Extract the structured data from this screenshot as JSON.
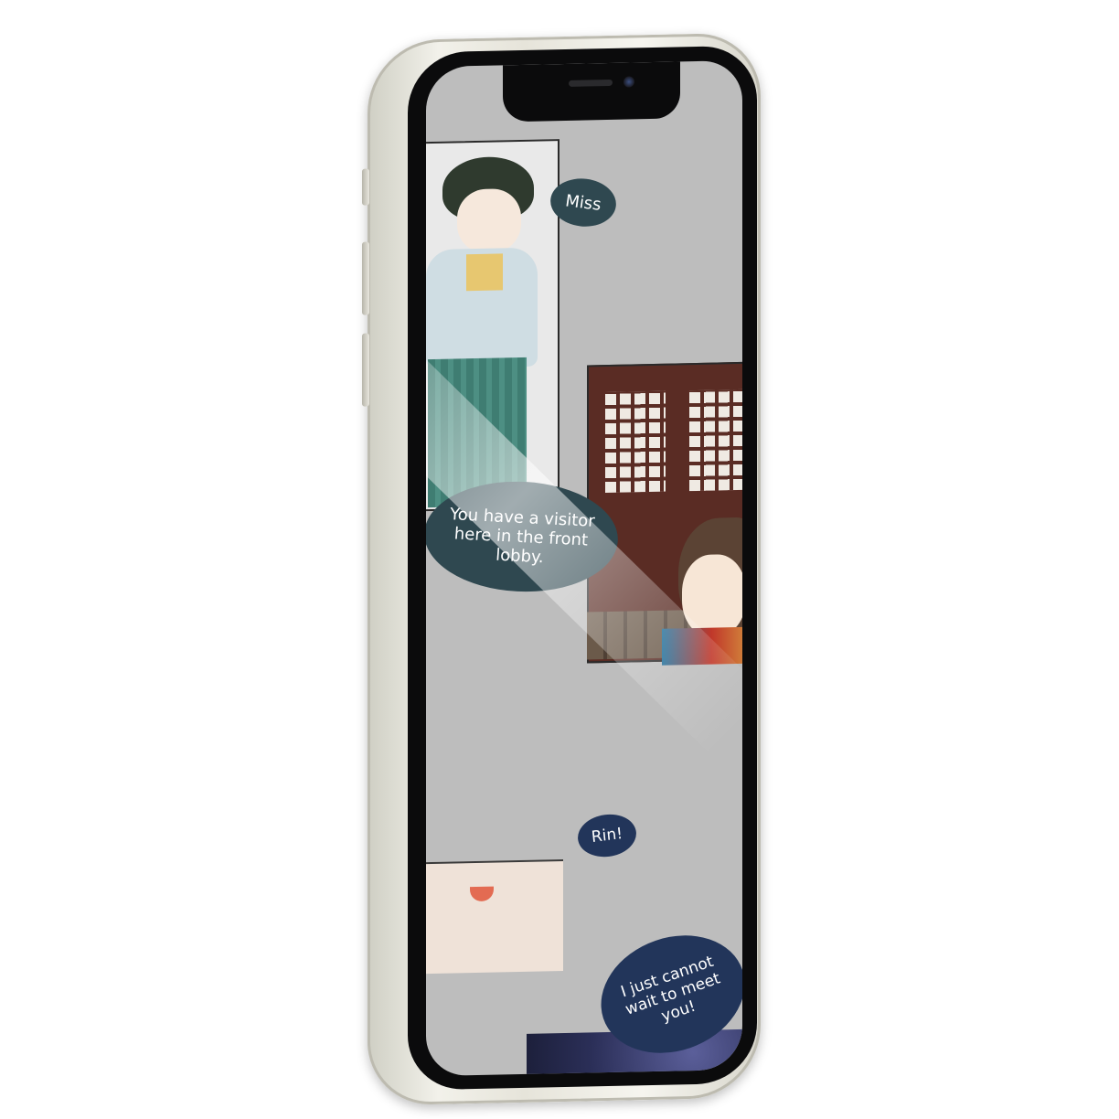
{
  "device": {
    "model_color": "white"
  },
  "comic": {
    "bubbles": [
      {
        "text": "Miss"
      },
      {
        "text": "You have a visitor here in the front lobby."
      },
      {
        "text": "Rin!"
      },
      {
        "text": "I just cannot wait to meet you!"
      }
    ]
  },
  "colors": {
    "bubble_dark_teal": "#2f4850",
    "bubble_navy": "#22355a",
    "screen_background": "#bdbdbd"
  }
}
